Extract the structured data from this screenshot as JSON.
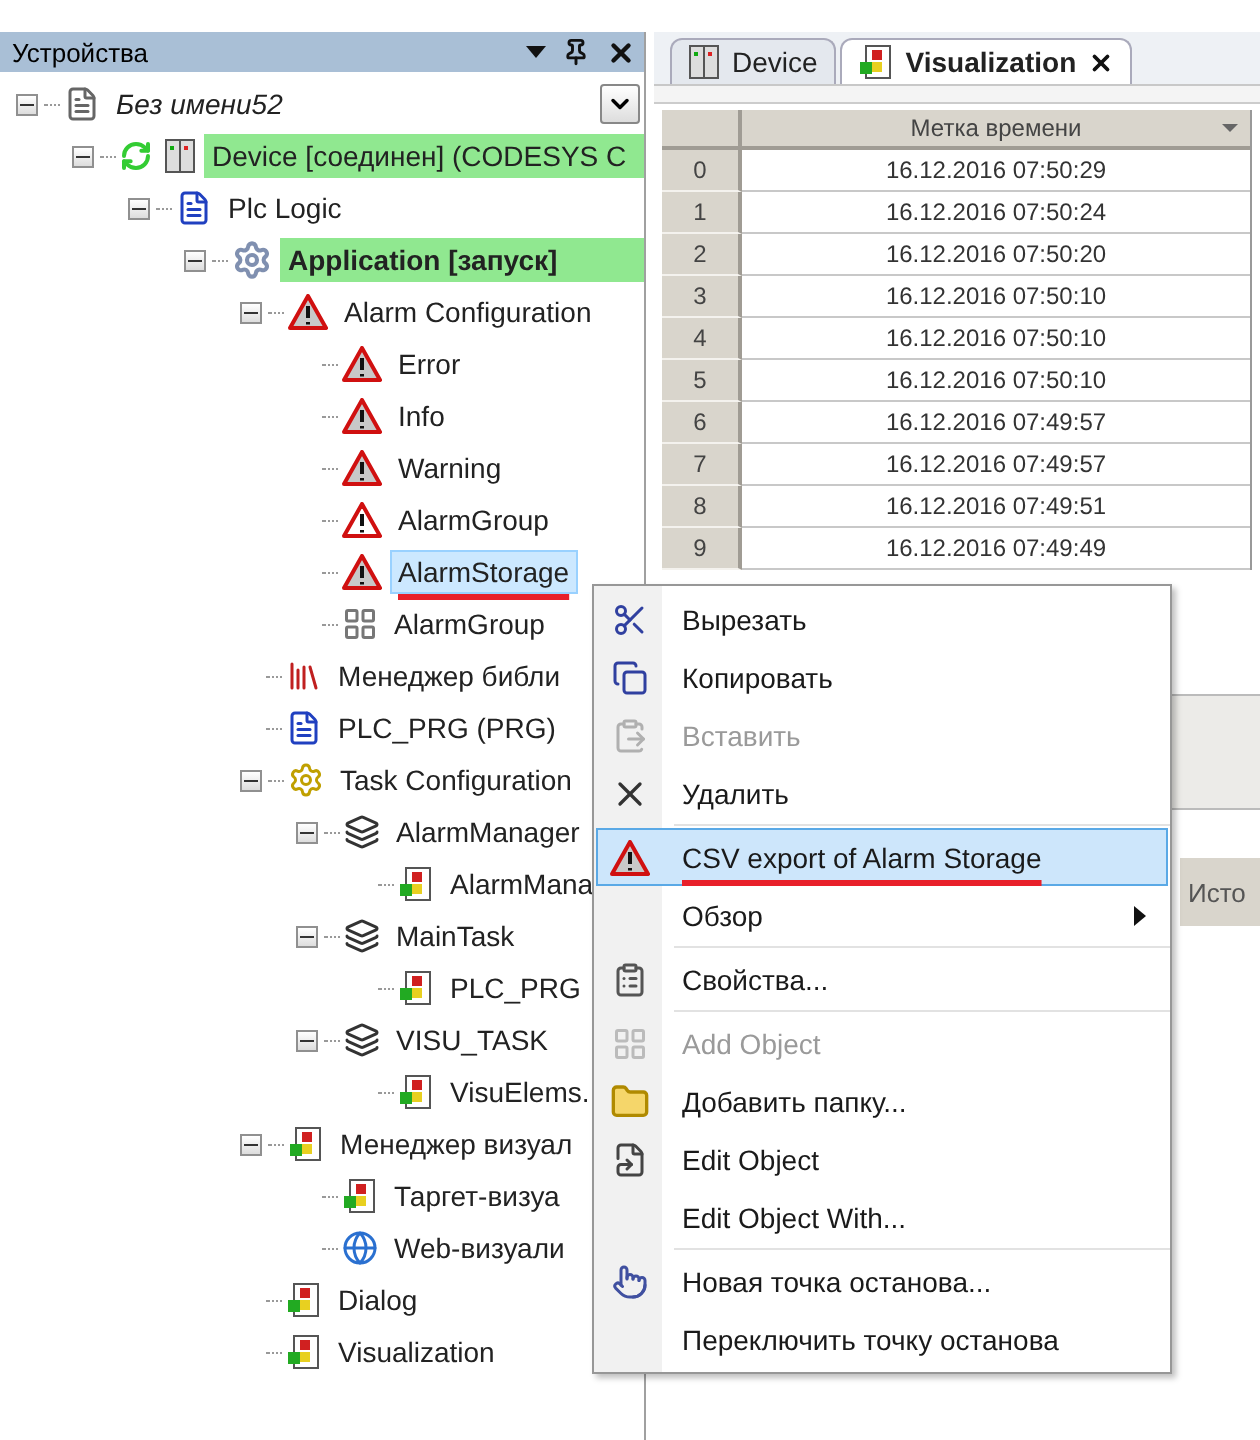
{
  "devices_panel": {
    "title": "Устройства",
    "tree": [
      {
        "label": "Без имени52",
        "kind": "project",
        "expanded": true,
        "selected": false,
        "online": false,
        "children": [
          {
            "label": "Device [соединен] (CODESYS C",
            "kind": "device",
            "expanded": true,
            "selected": false,
            "online": true,
            "children": [
              {
                "label": "Plc Logic",
                "kind": "plc-logic",
                "expanded": true,
                "selected": false,
                "online": false,
                "children": [
                  {
                    "label": "Application [запуск]",
                    "kind": "application",
                    "expanded": true,
                    "selected": false,
                    "online": true,
                    "children": [
                      {
                        "label": "Alarm Configuration",
                        "kind": "alarm-config",
                        "expanded": true,
                        "selected": false,
                        "online": false,
                        "children": [
                          {
                            "label": "Error",
                            "kind": "alarm-class",
                            "selected": false,
                            "online": false
                          },
                          {
                            "label": "Info",
                            "kind": "alarm-class",
                            "selected": false,
                            "online": false
                          },
                          {
                            "label": "Warning",
                            "kind": "alarm-class",
                            "selected": false,
                            "online": false
                          },
                          {
                            "label": "AlarmGroup",
                            "kind": "alarm-group",
                            "selected": false,
                            "online": false
                          },
                          {
                            "label": "AlarmStorage",
                            "kind": "alarm-storage",
                            "selected": true,
                            "online": false,
                            "underlined": true
                          },
                          {
                            "label": "AlarmGroup",
                            "kind": "alarm-table",
                            "selected": false,
                            "online": false
                          }
                        ]
                      },
                      {
                        "label": "Менеджер библи",
                        "kind": "library",
                        "selected": false,
                        "online": false
                      },
                      {
                        "label": "PLC_PRG (PRG)",
                        "kind": "pou",
                        "selected": false,
                        "online": false
                      },
                      {
                        "label": "Task Configuration",
                        "kind": "task-config",
                        "expanded": true,
                        "selected": false,
                        "online": false,
                        "children": [
                          {
                            "label": "AlarmManager",
                            "kind": "task",
                            "expanded": true,
                            "selected": false,
                            "online": false,
                            "children": [
                              {
                                "label": "AlarmMana",
                                "kind": "program-call",
                                "selected": false,
                                "online": false
                              }
                            ]
                          },
                          {
                            "label": "MainTask",
                            "kind": "task",
                            "expanded": true,
                            "selected": false,
                            "online": false,
                            "children": [
                              {
                                "label": "PLC_PRG",
                                "kind": "program-call",
                                "selected": false,
                                "online": false
                              }
                            ]
                          },
                          {
                            "label": "VISU_TASK",
                            "kind": "task",
                            "expanded": true,
                            "selected": false,
                            "online": false,
                            "children": [
                              {
                                "label": "VisuElems.",
                                "kind": "program-call",
                                "selected": false,
                                "online": false
                              }
                            ]
                          }
                        ]
                      },
                      {
                        "label": "Менеджер визуал",
                        "kind": "visu-manager",
                        "expanded": true,
                        "selected": false,
                        "online": false,
                        "children": [
                          {
                            "label": "Таргет-визуа",
                            "kind": "target-visu",
                            "selected": false,
                            "online": false
                          },
                          {
                            "label": "Web-визуали",
                            "kind": "web-visu",
                            "selected": false,
                            "online": false
                          }
                        ]
                      },
                      {
                        "label": "Dialog",
                        "kind": "visu",
                        "selected": false,
                        "online": false
                      },
                      {
                        "label": "Visualization",
                        "kind": "visu",
                        "selected": false,
                        "online": false
                      }
                    ]
                  }
                ]
              }
            ]
          }
        ]
      }
    ]
  },
  "editor": {
    "tabs": [
      {
        "label": "Device",
        "kind": "device",
        "selected": false
      },
      {
        "label": "Visualization",
        "kind": "visu",
        "selected": true
      }
    ],
    "table": {
      "columns": [
        "Метка времени"
      ],
      "rows": [
        {
          "index": "0",
          "time": "16.12.2016 07:50:29"
        },
        {
          "index": "1",
          "time": "16.12.2016 07:50:24"
        },
        {
          "index": "2",
          "time": "16.12.2016 07:50:20"
        },
        {
          "index": "3",
          "time": "16.12.2016 07:50:10"
        },
        {
          "index": "4",
          "time": "16.12.2016 07:50:10"
        },
        {
          "index": "5",
          "time": "16.12.2016 07:50:10"
        },
        {
          "index": "6",
          "time": "16.12.2016 07:49:57"
        },
        {
          "index": "7",
          "time": "16.12.2016 07:49:57"
        },
        {
          "index": "8",
          "time": "16.12.2016 07:49:51"
        },
        {
          "index": "9",
          "time": "16.12.2016 07:49:49"
        }
      ]
    },
    "lower_table": {
      "column_header": "Исто"
    }
  },
  "context_menu": {
    "items": [
      {
        "label": "Вырезать",
        "kind": "cut",
        "disabled": false,
        "selected": false
      },
      {
        "label": "Копировать",
        "kind": "copy",
        "disabled": false,
        "selected": false
      },
      {
        "label": "Вставить",
        "kind": "paste",
        "disabled": true,
        "selected": false
      },
      {
        "label": "Удалить",
        "kind": "delete",
        "disabled": false,
        "selected": false
      },
      {
        "label": "CSV export of Alarm Storage",
        "kind": "alarm-storage",
        "disabled": false,
        "selected": true,
        "separator_before": true,
        "underlined": true
      },
      {
        "label": "Обзор",
        "disabled": false,
        "selected": false,
        "submenu": true
      },
      {
        "label": "Свойства...",
        "kind": "properties",
        "disabled": false,
        "selected": false,
        "separator_before": true
      },
      {
        "label": "Add Object",
        "kind": "add-object",
        "disabled": true,
        "selected": false,
        "separator_before": true
      },
      {
        "label": "Добавить папку...",
        "kind": "folder",
        "disabled": false,
        "selected": false
      },
      {
        "label": "Edit Object",
        "kind": "edit",
        "disabled": false,
        "selected": false
      },
      {
        "label": "Edit Object With...",
        "disabled": false,
        "selected": false
      },
      {
        "label": "Новая точка останова...",
        "kind": "breakpoint",
        "disabled": false,
        "selected": false,
        "separator_before": true
      },
      {
        "label": "Переключить точку останова",
        "disabled": false,
        "selected": false
      }
    ]
  }
}
